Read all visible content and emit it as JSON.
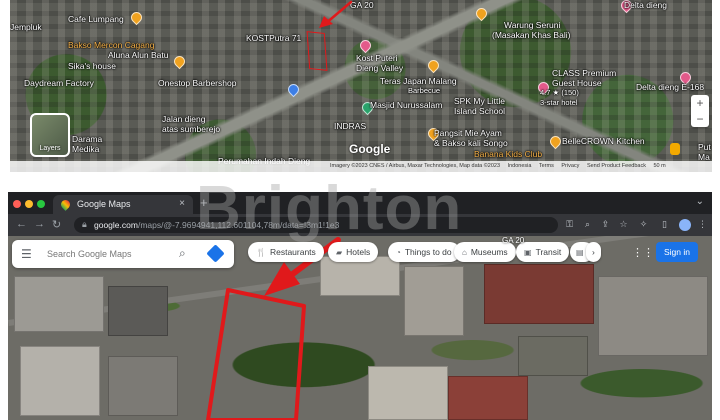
{
  "top_map": {
    "labels": [
      {
        "text": "Cafe Lumpang",
        "style": "white"
      },
      {
        "text": "Bakso Mercon Cagang",
        "style": "orange"
      },
      {
        "text": "Aluna Alun Batu",
        "style": "white"
      },
      {
        "text": "Sika's house",
        "style": "white"
      },
      {
        "text": "Daydream Factory",
        "style": "white"
      },
      {
        "text": "Onestop Barbershop",
        "style": "white"
      },
      {
        "text": "Jalan dieng",
        "style": "white"
      },
      {
        "text": "atas sumberejo",
        "style": "white"
      },
      {
        "text": "KOSTPutra 71",
        "style": "white"
      },
      {
        "text": "Kost Puteri",
        "style": "white"
      },
      {
        "text": "Dieng Valley",
        "style": "white"
      },
      {
        "text": "Teras Japan Malang",
        "style": "white"
      },
      {
        "text": "Barbecue",
        "style": "white"
      },
      {
        "text": "Masjid Nurussalam",
        "style": "white"
      },
      {
        "text": "SPK My Little",
        "style": "white"
      },
      {
        "text": "Island School",
        "style": "white"
      },
      {
        "text": "INDRAS",
        "style": "white"
      },
      {
        "text": "Pangsit Mie Ayam",
        "style": "white"
      },
      {
        "text": "& Bakso kali Songo",
        "style": "white"
      },
      {
        "text": "Banana Kids Club",
        "style": "orange"
      },
      {
        "text": "Warung Seruni",
        "style": "white"
      },
      {
        "text": "(Masakan Khas Bali)",
        "style": "white"
      },
      {
        "text": "CLASS Premium",
        "style": "white"
      },
      {
        "text": "Guest House",
        "style": "white"
      },
      {
        "text": "4.7 ★ (150)",
        "style": "white"
      },
      {
        "text": "3-star hotel",
        "style": "white"
      },
      {
        "text": "Delta dieng E-168",
        "style": "white"
      },
      {
        "text": "BelleCROWN Kitchen",
        "style": "white"
      },
      {
        "text": "Perumahan Indah Dieng",
        "style": "white"
      },
      {
        "text": "GA 20",
        "style": "white"
      },
      {
        "text": "Jempluk",
        "style": "white"
      },
      {
        "text": "Darama",
        "style": "white"
      },
      {
        "text": "Medika",
        "style": "white"
      },
      {
        "text": "Delta dieng",
        "style": "white"
      },
      {
        "text": "Put",
        "style": "white"
      },
      {
        "text": "Ma",
        "style": "white"
      }
    ],
    "layers_label": "Layers",
    "google_logo": "Google",
    "attribution": [
      "Imagery ©2023 CNES / Airbus, Maxar Technologies, Map data ©2023",
      "Indonesia",
      "Terms",
      "Privacy",
      "Send Product Feedback",
      "50 m"
    ]
  },
  "watermark": "Brighton",
  "browser": {
    "tab_title": "Google Maps",
    "tab_close": "×",
    "new_tab": "+",
    "tab_menu": "⌄",
    "back": "←",
    "forward": "→",
    "reload": "↻",
    "url_host": "google.com",
    "url_path": "/maps/@-7.9694941,112.601104,78m/data=!3m1!1e3",
    "icons": [
      "key",
      "search",
      "share",
      "star",
      "extensions",
      "sidebar",
      "profile",
      "more"
    ]
  },
  "maps_ui": {
    "search_placeholder": "Search Google Maps",
    "chips": [
      {
        "icon": "restaurant-icon",
        "glyph": "🍴",
        "label": "Restaurants"
      },
      {
        "icon": "hotel-icon",
        "glyph": "▰",
        "label": "Hotels"
      },
      {
        "icon": "things-to-do-icon",
        "glyph": "◔",
        "label": "Things to do"
      },
      {
        "icon": "museum-icon",
        "glyph": "⌂",
        "label": "Museums"
      },
      {
        "icon": "transit-icon",
        "glyph": "▣",
        "label": "Transit"
      },
      {
        "icon": "pharmacy-icon",
        "glyph": "▤",
        "label": ""
      }
    ],
    "chips_more": "›",
    "sign_in": "Sign in",
    "map_label": "GA 20"
  },
  "colors": {
    "annotation_red": "#e0191b",
    "google_blue": "#1a73e8"
  }
}
